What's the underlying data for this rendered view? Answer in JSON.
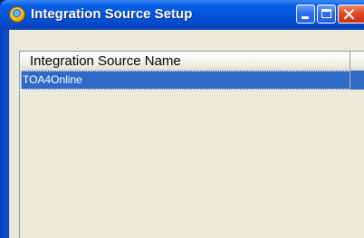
{
  "window": {
    "title": "Integration Source Setup",
    "controls": {
      "minimize": "minimize",
      "maximize": "maximize",
      "close": "close"
    }
  },
  "listview": {
    "columns": [
      "Integration Source Name",
      ""
    ],
    "rows": [
      {
        "name": "TOA4Online",
        "selected": true
      }
    ]
  },
  "colors": {
    "titlebar": "#0354d8",
    "selection": "#316ac5",
    "client": "#ece9d8"
  },
  "icons": {
    "app": "integration-gear-icon"
  }
}
